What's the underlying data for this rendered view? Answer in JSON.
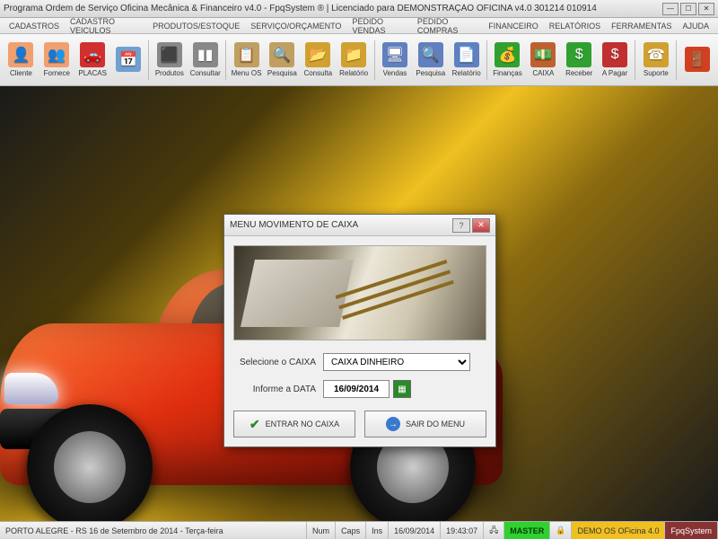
{
  "window": {
    "title": "Programa Ordem de Serviço Oficina Mecânica & Financeiro v4.0 - FpqSystem ® | Licenciado para DEMONSTRAÇÃO OFICINA v4.0 301214 010914"
  },
  "menu": [
    "CADASTROS",
    "CADASTRO VEICULOS",
    "PRODUTOS/ESTOQUE",
    "SERVIÇO/ORÇAMENTO",
    "PEDIDO VENDAS",
    "PEDIDO COMPRAS",
    "FINANCEIRO",
    "RELATÓRIOS",
    "FERRAMENTAS",
    "AJUDA"
  ],
  "toolbar": [
    {
      "label": "Cliente",
      "color": "#f0a070",
      "glyph": "👤"
    },
    {
      "label": "Fornece",
      "color": "#f0a070",
      "glyph": "👥"
    },
    {
      "label": "PLACAS",
      "color": "#d03030",
      "glyph": "🚗"
    },
    {
      "label": "",
      "color": "#70a0d0",
      "glyph": "📅"
    },
    {
      "label": "Produtos",
      "color": "#888",
      "glyph": "⬛"
    },
    {
      "label": "Consultar",
      "color": "#888",
      "glyph": "▮▮"
    },
    {
      "label": "Menu OS",
      "color": "#c0a060",
      "glyph": "📋"
    },
    {
      "label": "Pesquisa",
      "color": "#c0a060",
      "glyph": "🔍"
    },
    {
      "label": "Consulta",
      "color": "#d0a030",
      "glyph": "📂"
    },
    {
      "label": "Relatório",
      "color": "#d0a030",
      "glyph": "📁"
    },
    {
      "label": "Vendas",
      "color": "#6080c0",
      "glyph": "🖥"
    },
    {
      "label": "Pesquisa",
      "color": "#6080c0",
      "glyph": "🔍"
    },
    {
      "label": "Relatório",
      "color": "#6080c0",
      "glyph": "📄"
    },
    {
      "label": "Finanças",
      "color": "#30a030",
      "glyph": "💰"
    },
    {
      "label": "CAIXA",
      "color": "#c06030",
      "glyph": "💵"
    },
    {
      "label": "Receber",
      "color": "#30a030",
      "glyph": "$"
    },
    {
      "label": "A Pagar",
      "color": "#c03030",
      "glyph": "$"
    },
    {
      "label": "Suporte",
      "color": "#d0a030",
      "glyph": "☎"
    },
    {
      "label": "",
      "color": "#d04020",
      "glyph": "🚪"
    }
  ],
  "dialog": {
    "title": "MENU MOVIMENTO DE CAIXA",
    "caixa_label": "Selecione o CAIXA",
    "caixa_value": "CAIXA DINHEIRO",
    "data_label": "Informe a DATA",
    "data_value": "16/09/2014",
    "btn_enter": "ENTRAR NO CAIXA",
    "btn_exit": "SAIR DO MENU"
  },
  "status": {
    "location": "PORTO ALEGRE - RS 16 de Setembro de 2014 - Terça-feira",
    "num": "Num",
    "caps": "Caps",
    "ins": "Ins",
    "date": "16/09/2014",
    "time": "19:43:07",
    "master": "MASTER",
    "demo": "DEMO OS OFicina 4.0",
    "brand": "FpqSystem"
  }
}
